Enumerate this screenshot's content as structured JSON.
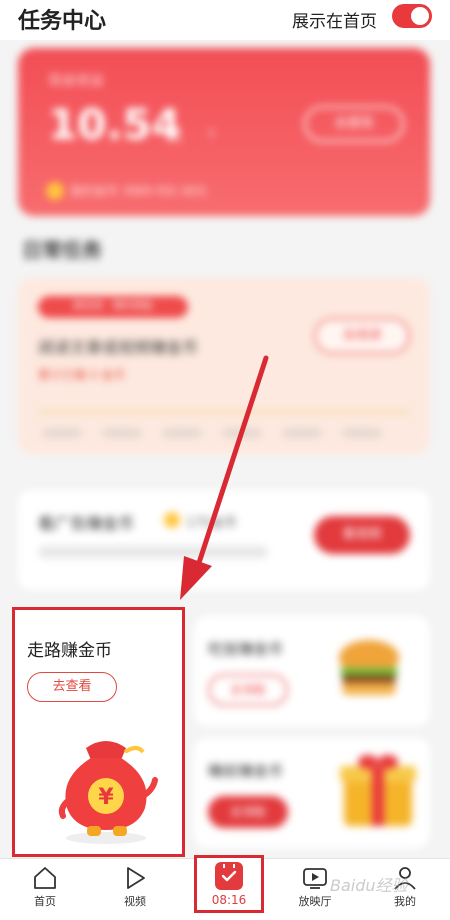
{
  "header": {
    "title": "任务中心",
    "home_label": "展示在首页",
    "toggle_on": true
  },
  "cash_card": {
    "amount": "10.54",
    "cash_button": "去提现"
  },
  "walk_card": {
    "title": "走路赚金币",
    "button": "去查看"
  },
  "bottom_nav": {
    "home": "首页",
    "video": "视频",
    "timer": "08:16",
    "theater": "放映厅",
    "mine": "我的"
  },
  "watermark": "Baidu经验",
  "colors": {
    "accent": "#e23a3d",
    "highlight_border": "#d92a33"
  }
}
